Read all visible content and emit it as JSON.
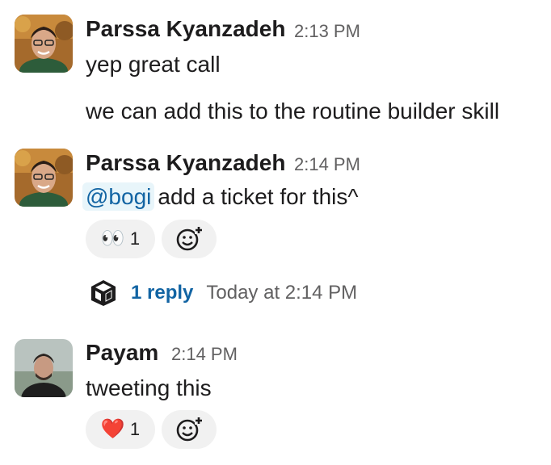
{
  "messages": [
    {
      "author": "Parssa Kyanzadeh",
      "time": "2:13 PM",
      "lines": [
        "yep great call",
        "we can add this to the routine builder skill"
      ]
    },
    {
      "author": "Parssa Kyanzadeh",
      "time": "2:14 PM",
      "mention": "@bogi",
      "text": "add a ticket for this^",
      "reaction": {
        "emoji": "👀",
        "count": "1",
        "icon": "eyes-emoji"
      },
      "thread": {
        "reply_count": "1 reply",
        "last_reply": "Today at 2:14 PM"
      }
    },
    {
      "author": "Payam",
      "time": "2:14 PM",
      "text": "tweeting this",
      "reaction": {
        "emoji": "❤️",
        "count": "1",
        "icon": "heart-emoji"
      }
    }
  ],
  "icons": {
    "add_reaction": "add-reaction-icon",
    "thread_avatar": "bot-cube-icon"
  },
  "colors": {
    "link": "#1264a3",
    "mention_bg": "#e8f5fa",
    "pill_bg": "#f1f1f1",
    "muted": "#616061"
  }
}
